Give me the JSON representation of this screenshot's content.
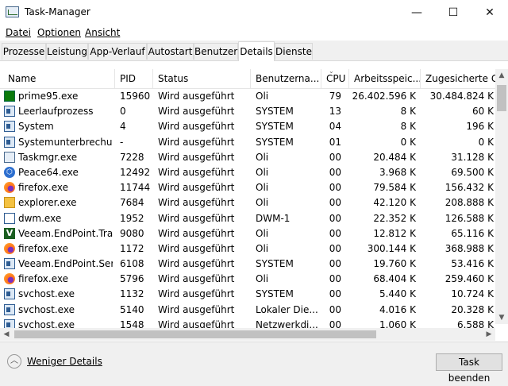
{
  "window": {
    "title": "Task-Manager",
    "minimize": "—",
    "maximize": "☐",
    "close": "✕"
  },
  "menu": [
    "Datei",
    "Optionen",
    "Ansicht"
  ],
  "tabs": [
    "Prozesse",
    "Leistung",
    "App-Verlauf",
    "Autostart",
    "Benutzer",
    "Details",
    "Dienste"
  ],
  "active_tab": "Details",
  "columns": [
    "Name",
    "PID",
    "Status",
    "Benutzerna...",
    "CPU",
    "Arbeitsspeic...",
    "Zugesicherte G..."
  ],
  "sort_column": "CPU",
  "rows": [
    {
      "icon": "prime95-icon",
      "name": "prime95.exe",
      "pid": "15960",
      "status": "Wird ausgeführt",
      "user": "Oli",
      "cpu": "79",
      "mem": "26.402.596 K",
      "commit": "30.484.824 K"
    },
    {
      "icon": "process-icon",
      "name": "Leerlaufprozess",
      "pid": "0",
      "status": "Wird ausgeführt",
      "user": "SYSTEM",
      "cpu": "13",
      "mem": "8 K",
      "commit": "60 K"
    },
    {
      "icon": "process-icon",
      "name": "System",
      "pid": "4",
      "status": "Wird ausgeführt",
      "user": "SYSTEM",
      "cpu": "04",
      "mem": "8 K",
      "commit": "196 K"
    },
    {
      "icon": "process-icon",
      "name": "Systemunterbrechun...",
      "pid": "-",
      "status": "Wird ausgeführt",
      "user": "SYSTEM",
      "cpu": "01",
      "mem": "0 K",
      "commit": "0 K"
    },
    {
      "icon": "taskmgr-icon",
      "name": "Taskmgr.exe",
      "pid": "7228",
      "status": "Wird ausgeführt",
      "user": "Oli",
      "cpu": "00",
      "mem": "20.484 K",
      "commit": "31.128 K"
    },
    {
      "icon": "peace-icon",
      "name": "Peace64.exe",
      "pid": "12492",
      "status": "Wird ausgeführt",
      "user": "Oli",
      "cpu": "00",
      "mem": "3.968 K",
      "commit": "69.500 K"
    },
    {
      "icon": "firefox-icon",
      "name": "firefox.exe",
      "pid": "11744",
      "status": "Wird ausgeführt",
      "user": "Oli",
      "cpu": "00",
      "mem": "79.584 K",
      "commit": "156.432 K"
    },
    {
      "icon": "explorer-icon",
      "name": "explorer.exe",
      "pid": "7684",
      "status": "Wird ausgeführt",
      "user": "Oli",
      "cpu": "00",
      "mem": "42.120 K",
      "commit": "208.888 K"
    },
    {
      "icon": "dwm-icon",
      "name": "dwm.exe",
      "pid": "1952",
      "status": "Wird ausgeführt",
      "user": "DWM-1",
      "cpu": "00",
      "mem": "22.352 K",
      "commit": "126.588 K"
    },
    {
      "icon": "veeam-icon",
      "name": "Veeam.EndPoint.Tray...",
      "pid": "9080",
      "status": "Wird ausgeführt",
      "user": "Oli",
      "cpu": "00",
      "mem": "12.812 K",
      "commit": "65.116 K"
    },
    {
      "icon": "firefox-icon",
      "name": "firefox.exe",
      "pid": "1172",
      "status": "Wird ausgeführt",
      "user": "Oli",
      "cpu": "00",
      "mem": "300.144 K",
      "commit": "368.988 K"
    },
    {
      "icon": "process-icon",
      "name": "Veeam.EndPoint.Servi...",
      "pid": "6108",
      "status": "Wird ausgeführt",
      "user": "SYSTEM",
      "cpu": "00",
      "mem": "19.760 K",
      "commit": "53.416 K"
    },
    {
      "icon": "firefox-icon",
      "name": "firefox.exe",
      "pid": "5796",
      "status": "Wird ausgeführt",
      "user": "Oli",
      "cpu": "00",
      "mem": "68.404 K",
      "commit": "259.460 K"
    },
    {
      "icon": "process-icon",
      "name": "svchost.exe",
      "pid": "1132",
      "status": "Wird ausgeführt",
      "user": "SYSTEM",
      "cpu": "00",
      "mem": "5.440 K",
      "commit": "10.724 K"
    },
    {
      "icon": "process-icon",
      "name": "svchost.exe",
      "pid": "5140",
      "status": "Wird ausgeführt",
      "user": "Lokaler Die...",
      "cpu": "00",
      "mem": "4.016 K",
      "commit": "20.328 K"
    },
    {
      "icon": "process-icon",
      "name": "svchost.exe",
      "pid": "1548",
      "status": "Wird ausgeführt",
      "user": "Netzwerkdi...",
      "cpu": "00",
      "mem": "1.060 K",
      "commit": "6.588 K"
    }
  ],
  "footer": {
    "fewer_details": "Weniger Details",
    "end_task": "Task beenden",
    "fewer_icon": "chevron-up-icon"
  },
  "scroll": {
    "up": "▲",
    "down": "▼",
    "left": "◀",
    "right": "▶"
  }
}
